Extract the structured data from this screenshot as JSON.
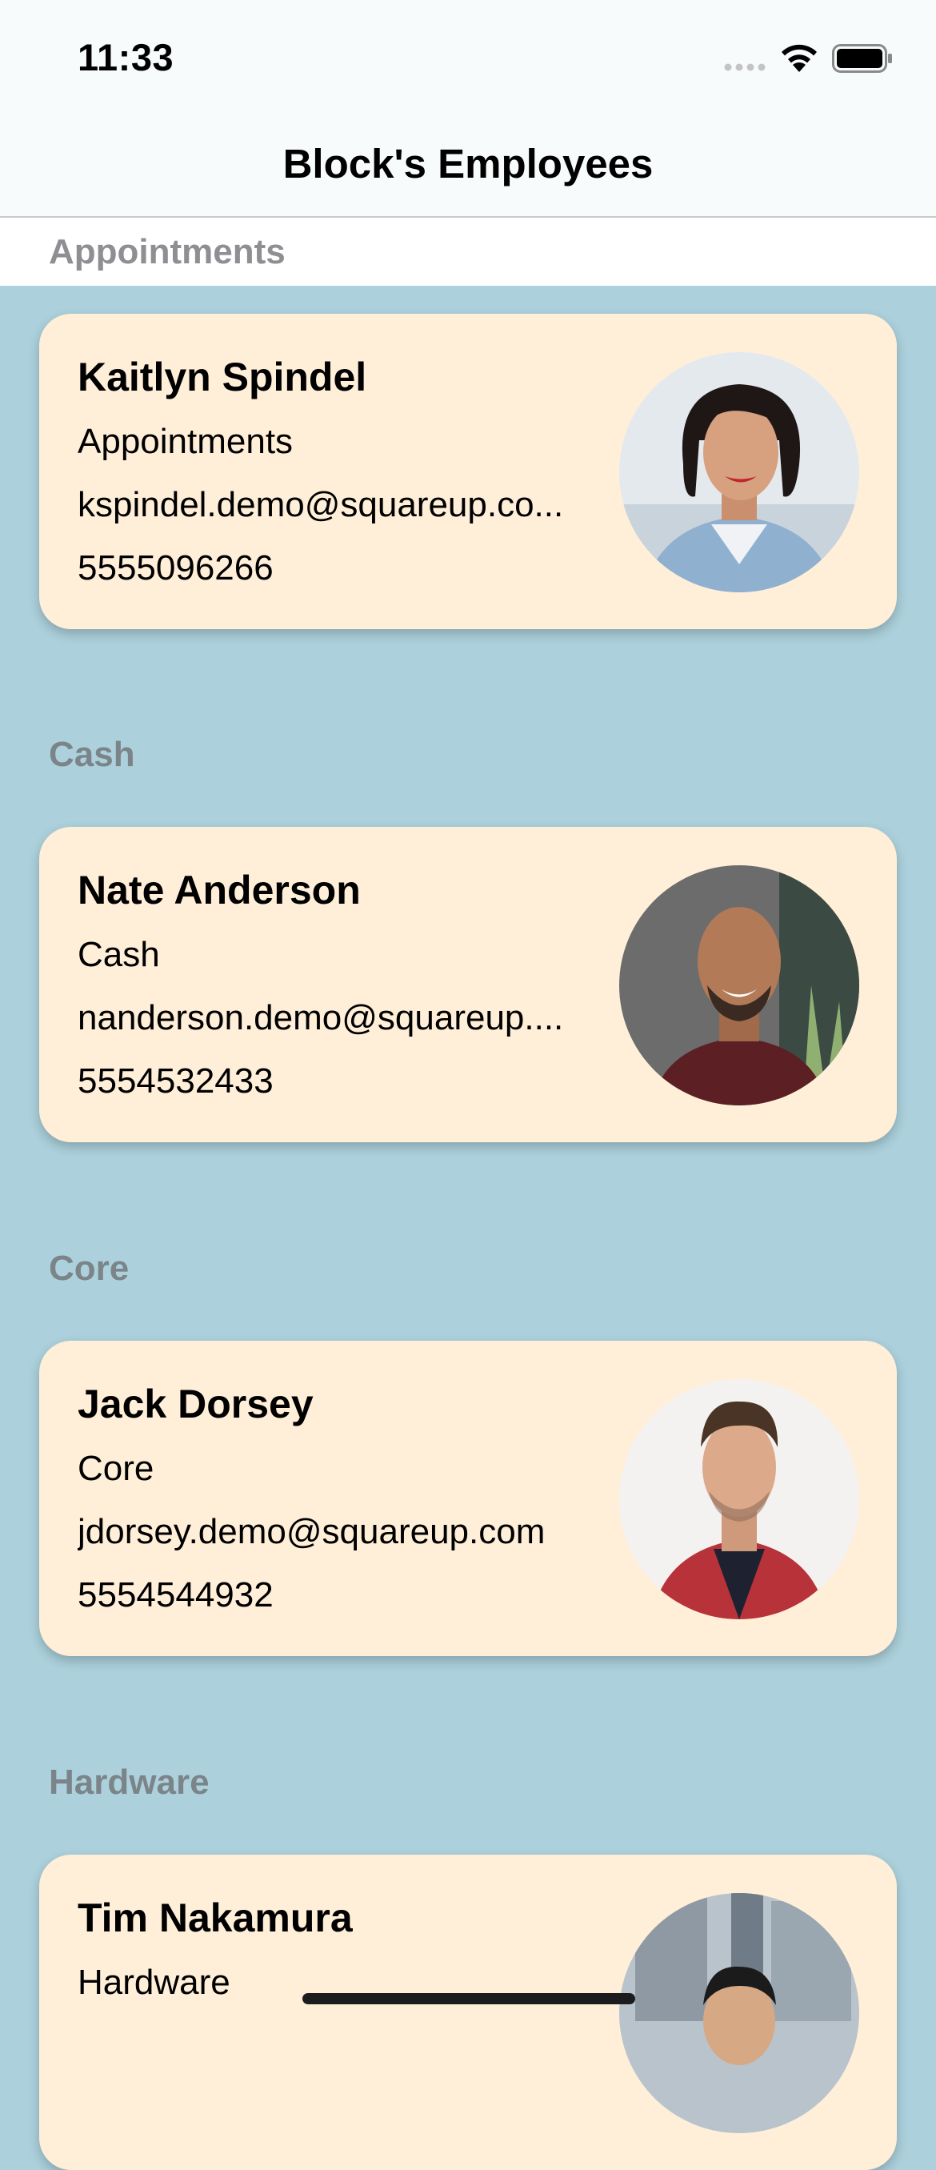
{
  "status_bar": {
    "time": "11:33"
  },
  "nav": {
    "title": "Block's Employees"
  },
  "sticky_section": "Appointments",
  "sections": [
    {
      "header": "Cash",
      "employee": {
        "name": "Nate Anderson",
        "team": "Cash",
        "email": "nanderson.demo@squareup....",
        "phone": "5554532433"
      }
    },
    {
      "header": "Core",
      "employee": {
        "name": "Jack Dorsey",
        "team": "Core",
        "email": "jdorsey.demo@squareup.com",
        "phone": "5554544932"
      }
    },
    {
      "header": "Hardware",
      "employee": {
        "name": "Tim Nakamura",
        "team": "Hardware"
      }
    }
  ],
  "first_card": {
    "name": "Kaitlyn Spindel",
    "team": "Appointments",
    "email": "kspindel.demo@squareup.co...",
    "phone": "5555096266"
  },
  "colors": {
    "background": "#acd1dc",
    "card": "#ffefd9",
    "section_header": "#7b8489"
  },
  "icons": [
    "signal-icon",
    "wifi-icon",
    "battery-icon"
  ]
}
